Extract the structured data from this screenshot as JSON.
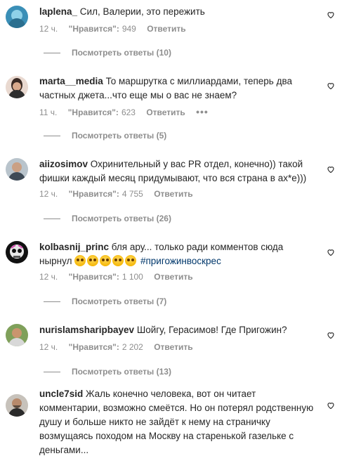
{
  "comments": [
    {
      "username": "laplena_",
      "text": "Сил, Валерии, это пережить",
      "time": "12 ч.",
      "likes_label": "\"Нравится\":",
      "likes": "949",
      "reply": "Ответить",
      "view_replies": "Посмотреть ответы (10)"
    },
    {
      "username": "marta__media",
      "text": "То маршрутка с миллиардами, теперь два частных джета...что еще мы о вас не знаем?",
      "time": "11 ч.",
      "likes_label": "\"Нравится\":",
      "likes": "623",
      "reply": "Ответить",
      "more": "•••",
      "view_replies": "Посмотреть ответы (5)"
    },
    {
      "username": "aiizosimov",
      "text": "Охринительный у вас PR отдел, конечно)) такой фишки каждый месяц придумывают, что вся страна в ах*е)))",
      "time": "12 ч.",
      "likes_label": "\"Нравится\":",
      "likes": "4 755",
      "reply": "Ответить",
      "view_replies": "Посмотреть ответы (26)"
    },
    {
      "username": "kolbasnij_princ",
      "text": "бля ару... только ради комментов сюда нырнул",
      "hashtag": "#пригожинвоскрес",
      "time": "12 ч.",
      "likes_label": "\"Нравится\":",
      "likes": "1 100",
      "reply": "Ответить",
      "view_replies": "Посмотреть ответы (7)"
    },
    {
      "username": "nurislamsharipbayev",
      "text": "Шойгу, Герасимов! Где Пригожин?",
      "time": "12 ч.",
      "likes_label": "\"Нравится\":",
      "likes": "2 202",
      "reply": "Ответить",
      "view_replies": "Посмотреть ответы (13)"
    },
    {
      "username": "uncle7sid",
      "text": "Жаль конечно человека, вот он читает комментарии, возможно смеётся. Но он потерял родственную душу и больше никто не зайдёт к нему на страничку возмущаясь походом на Москву на старенькой газельке с деньгами..."
    }
  ],
  "colors": {
    "text": "#262626",
    "secondary": "#8e8e8e",
    "hashtag": "#00376b"
  },
  "icons": {
    "like": "heart-outline-icon"
  }
}
